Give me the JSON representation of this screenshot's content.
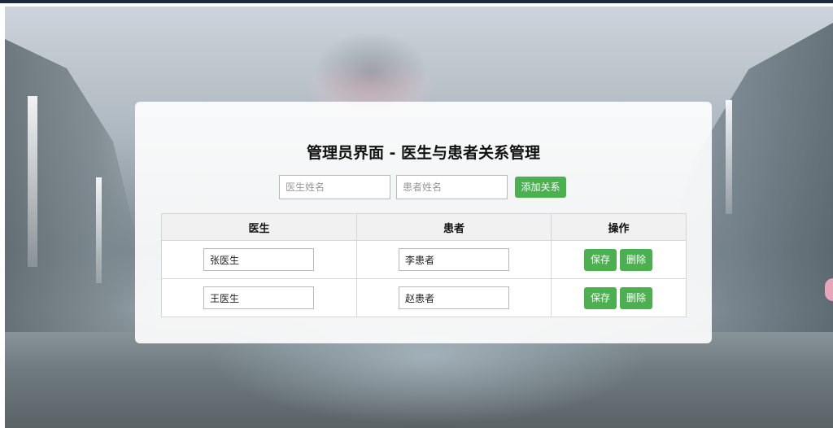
{
  "page": {
    "title": "管理员界面 - 医生与患者关系管理"
  },
  "form": {
    "doctor_placeholder": "医生姓名",
    "patient_placeholder": "患者姓名",
    "add_label": "添加关系"
  },
  "table": {
    "headers": [
      "医生",
      "患者",
      "操作"
    ],
    "rows": [
      {
        "doctor": "张医生",
        "patient": "李患者",
        "save_label": "保存",
        "delete_label": "删除"
      },
      {
        "doctor": "王医生",
        "patient": "赵患者",
        "save_label": "保存",
        "delete_label": "删除"
      }
    ]
  },
  "colors": {
    "accent": "#4caf50",
    "topbar": "#1e2a3d"
  }
}
